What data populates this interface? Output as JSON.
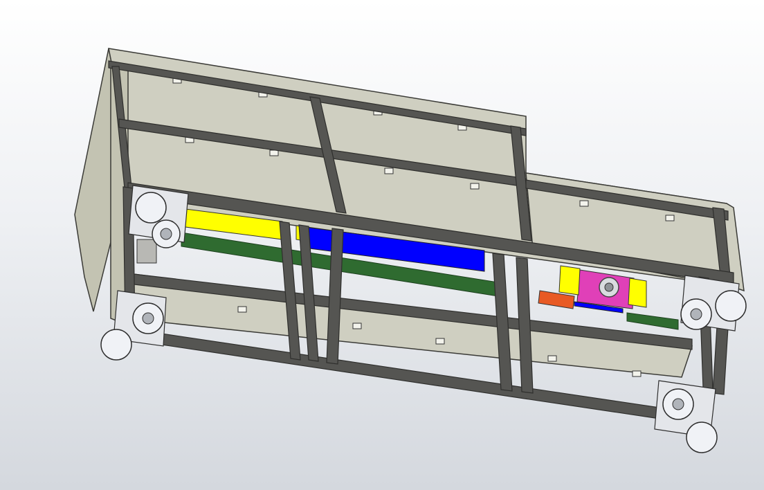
{
  "viewport": {
    "background_top": "#ffffff",
    "background_bottom": "#d4d8de"
  },
  "model": {
    "colors": {
      "panel": "#cfcfc1",
      "panel_side": "#c3c3b2",
      "frame": "#555552",
      "frame_edge": "#2e2e2c",
      "yellow_bar": "#ffff00",
      "blue_bar": "#0000ff",
      "green_rail": "#2f6b30",
      "magenta_block": "#e040b8",
      "orange_block": "#e85a24",
      "caster": "#f0f2f6",
      "bracket": "#e4e6ea"
    },
    "parts": [
      "frame",
      "top-panels",
      "side-panel",
      "yellow-bar",
      "blue-bar",
      "green-rail",
      "magenta-block",
      "orange-block",
      "caster-wheel"
    ]
  }
}
